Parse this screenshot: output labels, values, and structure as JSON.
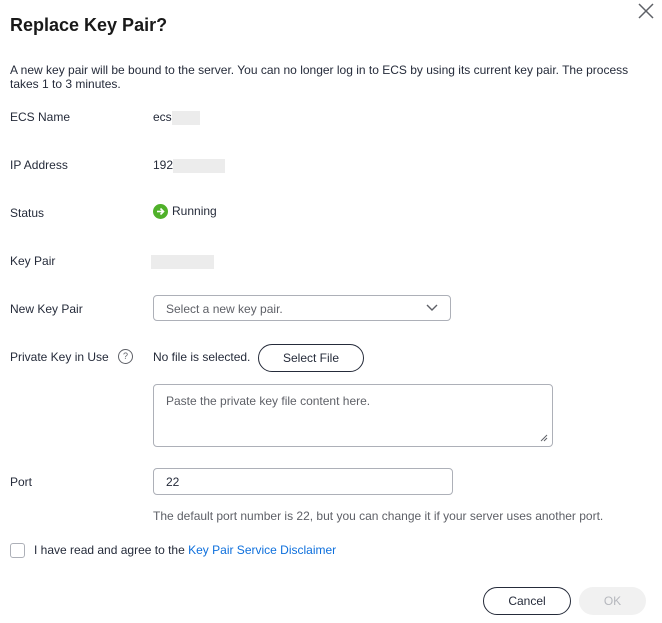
{
  "dialog": {
    "title": "Replace Key Pair?",
    "description": "A new key pair will be bound to the server. You can no longer log in to ECS by using its current key pair. The process takes 1 to 3 minutes."
  },
  "fields": {
    "ecs_name": {
      "label": "ECS Name",
      "value": "ecs"
    },
    "ip_address": {
      "label": "IP Address",
      "value": "192"
    },
    "status": {
      "label": "Status",
      "value": "Running",
      "color": "#50b12a"
    },
    "key_pair": {
      "label": "Key Pair",
      "value": ""
    },
    "new_key_pair": {
      "label": "New Key Pair",
      "placeholder": "Select a new key pair."
    },
    "private_key": {
      "label": "Private Key in Use",
      "help_icon": "question-circle-icon",
      "file_status": "No file is selected.",
      "select_file_label": "Select File",
      "textarea_placeholder": "Paste the private key file content here."
    },
    "port": {
      "label": "Port",
      "value": "22",
      "hint": "The default port number is 22, but you can change it if your server uses another port."
    }
  },
  "agreement": {
    "text": "I have read and agree to the ",
    "link": "Key Pair Service Disclaimer",
    "checked": false
  },
  "footer": {
    "cancel_label": "Cancel",
    "ok_label": "OK"
  },
  "colors": {
    "link": "#0d6fdc",
    "running": "#50b12a"
  }
}
